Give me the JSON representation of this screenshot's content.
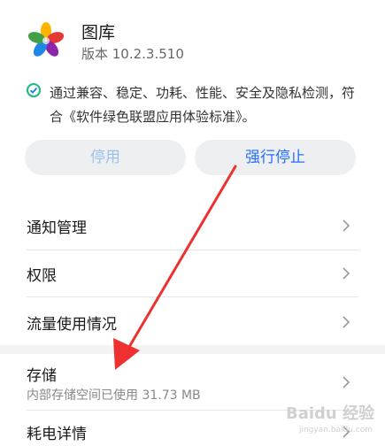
{
  "app": {
    "name": "图库",
    "version": "版本 10.2.3.510"
  },
  "certification": {
    "icon": "shield-check-icon",
    "text": "通过兼容、稳定、功耗、性能、安全及隐私检测，符合《软件绿色联盟应用体验标准》。"
  },
  "actions": {
    "disable_label": "停用",
    "force_stop_label": "强行停止"
  },
  "settings": [
    {
      "label": "通知管理"
    },
    {
      "label": "权限"
    },
    {
      "label": "流量使用情况"
    }
  ],
  "storage": {
    "label": "存储",
    "subtitle": "内部存储空间已使用 31.73 MB"
  },
  "battery": {
    "label": "耗电详情"
  },
  "watermark": {
    "text": "Baidu 经验",
    "sub": "jingyan.baidu.com"
  },
  "colors": {
    "accent": "#256fff",
    "annotation_arrow": "#ee3030"
  }
}
